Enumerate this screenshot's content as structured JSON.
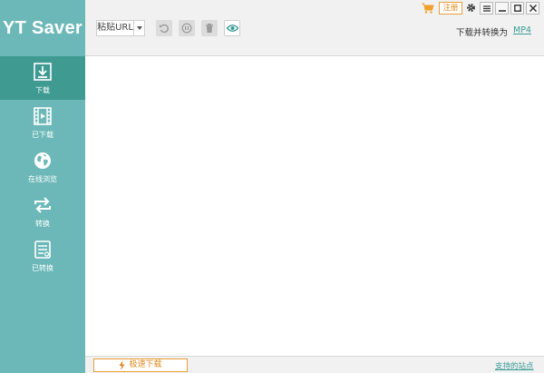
{
  "app": {
    "title": "YT Saver"
  },
  "sidebar": {
    "items": [
      {
        "label": "下载",
        "icon": "download-icon",
        "active": true
      },
      {
        "label": "已下载",
        "icon": "film-icon",
        "active": false
      },
      {
        "label": "在线浏览",
        "icon": "globe-icon",
        "active": false
      },
      {
        "label": "转换",
        "icon": "convert-icon",
        "active": false
      },
      {
        "label": "已转换",
        "icon": "document-icon",
        "active": false
      }
    ]
  },
  "toolbar": {
    "paste_label": "粘贴URL",
    "convert_label": "下载并转换为",
    "format": "MP4",
    "icons": [
      "undo-icon",
      "pause-icon",
      "trash-icon",
      "eye-icon"
    ]
  },
  "window": {
    "register_label": "注册",
    "icons": [
      "cart-icon",
      "gear-icon",
      "menu-icon",
      "minimize-icon",
      "maximize-icon",
      "close-icon"
    ]
  },
  "footer": {
    "speed_label": "极速下载",
    "sites_link": "支持的站点"
  },
  "colors": {
    "sidebar": "#6cb8b8",
    "sidebar_active": "#3f9a92",
    "accent": "#e08a1e",
    "link": "#3a9a94"
  }
}
